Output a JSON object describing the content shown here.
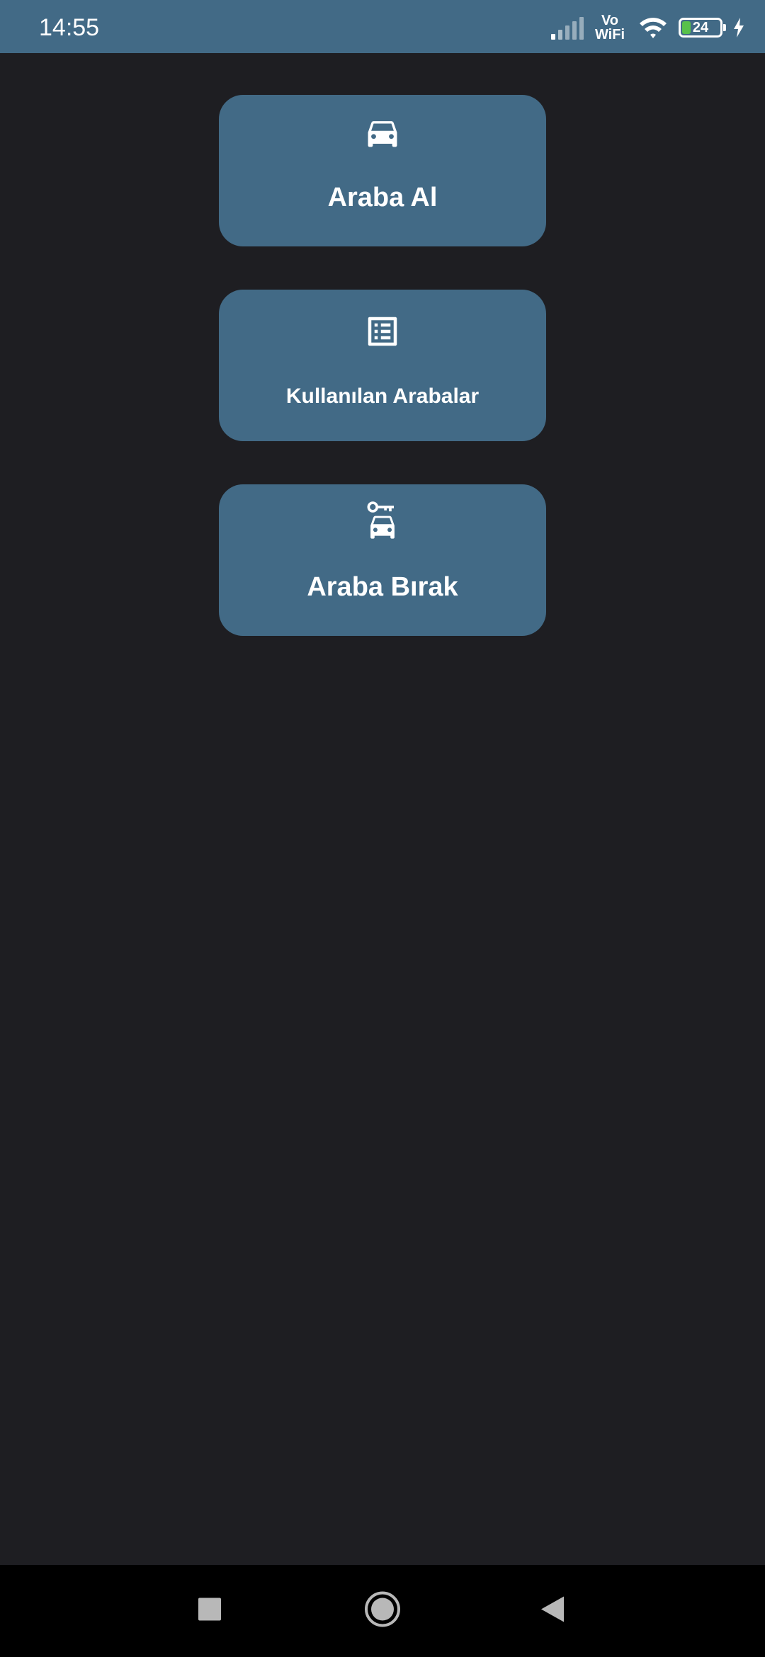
{
  "status_bar": {
    "time": "14:55",
    "vowifi_top": "Vo",
    "vowifi_bottom": "WiFi",
    "battery_level": "24",
    "battery_fraction": 0.24,
    "battery_color": "#58c14b"
  },
  "menu": {
    "items": [
      {
        "label": "Araba Al",
        "icon": "car-icon"
      },
      {
        "label": "Kullanılan Arabalar",
        "icon": "list-icon"
      },
      {
        "label": "Araba Bırak",
        "icon": "car-key-icon"
      }
    ]
  },
  "nav_bar": {
    "recent_icon": "square-icon",
    "home_icon": "circle-icon",
    "back_icon": "triangle-back-icon"
  },
  "colors": {
    "accent": "#426a86",
    "background": "#1e1e22",
    "nav_background": "#000000"
  }
}
